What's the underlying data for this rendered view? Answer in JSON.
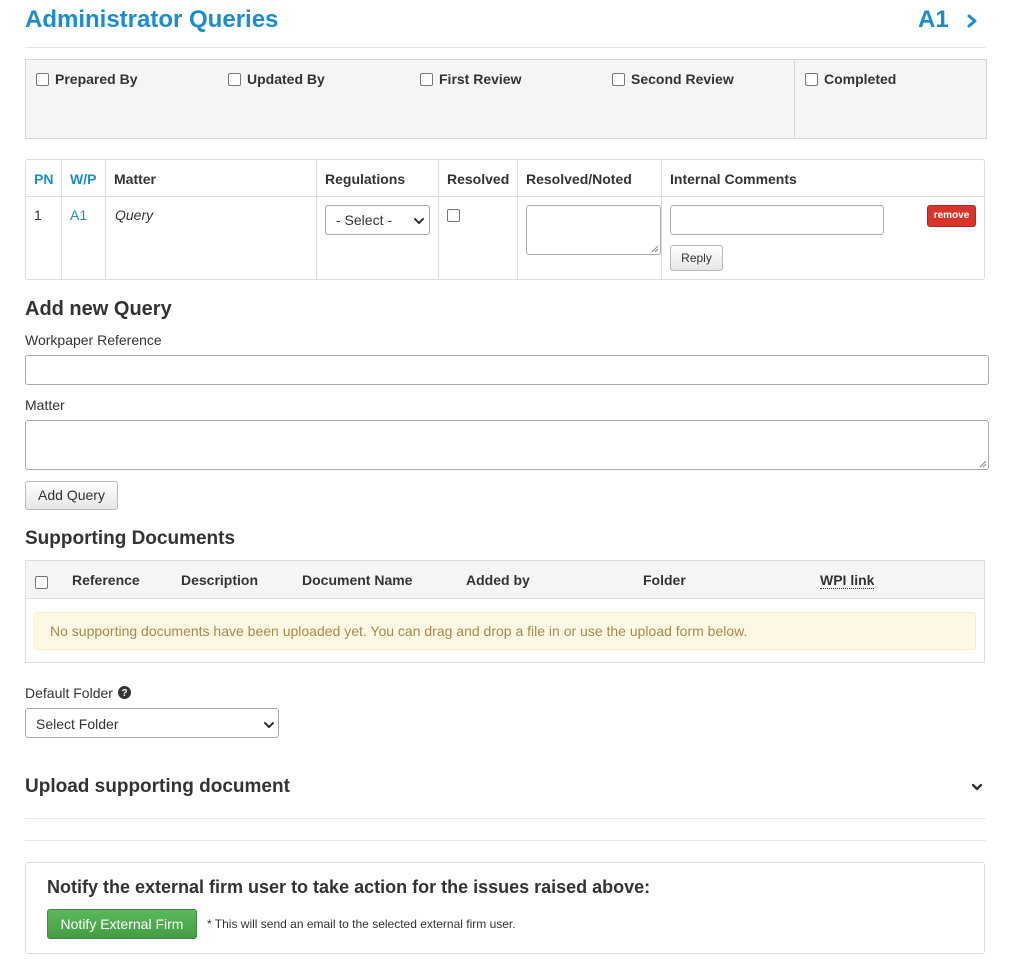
{
  "header": {
    "title": "Administrator Queries",
    "ref_code": "A1"
  },
  "signoff": {
    "items": [
      {
        "label": "Prepared By",
        "checked": false
      },
      {
        "label": "Updated By",
        "checked": false
      },
      {
        "label": "First Review",
        "checked": false
      },
      {
        "label": "Second Review",
        "checked": false
      },
      {
        "label": "Completed",
        "checked": false
      }
    ]
  },
  "queries_table": {
    "headers": [
      "PN",
      "W/P",
      "Matter",
      "Regulations",
      "Resolved",
      "Resolved/Noted",
      "Internal Comments"
    ],
    "rows": [
      {
        "pn": "1",
        "wp": "A1",
        "matter": "Query",
        "regulations_value": "- Select -",
        "resolved": false,
        "resolved_noted": "",
        "internal_comment": "",
        "reply_label": "Reply",
        "remove_label": "remove"
      }
    ]
  },
  "add_query": {
    "heading": "Add new Query",
    "wp_label": "Workpaper Reference",
    "wp_value": "",
    "matter_label": "Matter",
    "matter_value": "",
    "submit_label": "Add Query"
  },
  "supporting_documents": {
    "heading": "Supporting Documents",
    "headers": [
      "Reference",
      "Description",
      "Document Name",
      "Added by",
      "Folder",
      "WPI link"
    ],
    "empty_message": "No supporting documents have been uploaded yet. You can drag and drop a file in or use the upload form below."
  },
  "default_folder": {
    "label": "Default Folder",
    "value": "Select Folder"
  },
  "upload": {
    "heading": "Upload supporting document"
  },
  "notify": {
    "title": "Notify the external firm user to take action for the issues raised above:",
    "button_label": "Notify External Firm",
    "note": "* This will send an email to the selected external firm user."
  },
  "colors": {
    "accent": "#1a8ecd",
    "danger": "#d9342b",
    "success": "#5cb85c",
    "warning_bg": "#fcf8e3"
  }
}
